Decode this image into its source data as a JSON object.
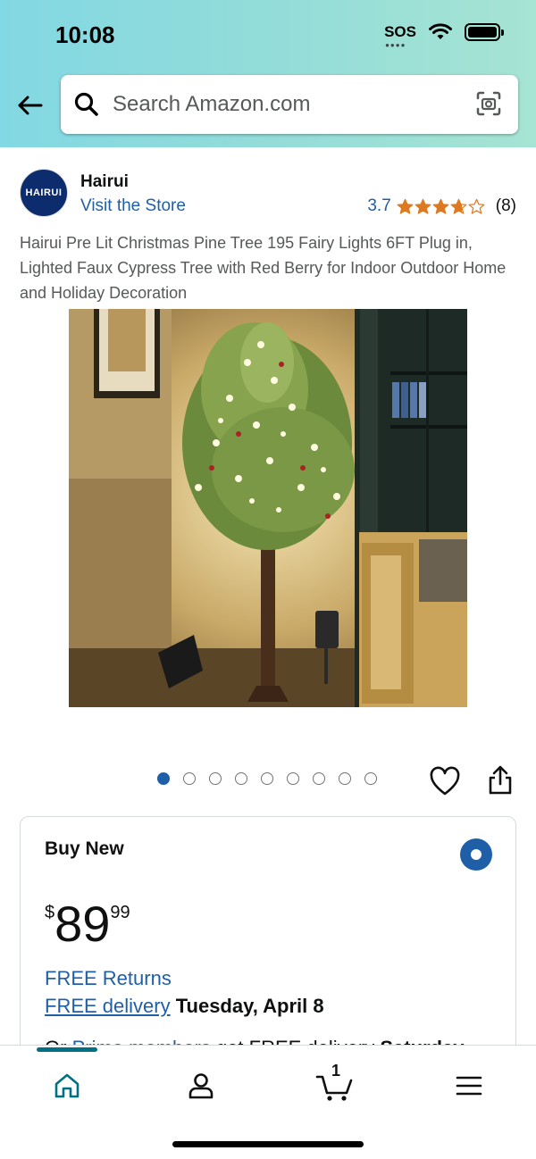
{
  "status_bar": {
    "time": "10:08",
    "carrier": "SOS"
  },
  "search": {
    "placeholder": "Search Amazon.com"
  },
  "store": {
    "logo_text": "HAIRUI",
    "name": "Hairui",
    "link": "Visit the Store",
    "rating": "3.7",
    "rating_value": 3.7,
    "rating_count": "(8)"
  },
  "product": {
    "title": "Hairui Pre Lit Christmas Pine Tree 195 Fairy Lights 6FT Plug in, Lighted Faux Cypress Tree with Red Berry for Indoor Outdoor Home and Holiday Decoration",
    "image_count": 9,
    "active_image": 0
  },
  "buy_box": {
    "label": "Buy New",
    "price_currency": "$",
    "price_whole": "89",
    "price_fraction": "99",
    "free_returns": "FREE Returns",
    "free_delivery_link": "FREE delivery",
    "delivery_date": "Tuesday, April 8",
    "cutoff_prefix": "Or",
    "cutoff_link": "Prime members",
    "cutoff_rest": "get FREE delivery",
    "cutoff_date": "Saturday"
  },
  "bottom_nav": {
    "items": [
      "home",
      "account",
      "cart",
      "menu"
    ],
    "active": "home",
    "cart_count": "1"
  },
  "colors": {
    "link": "#1f5fa8",
    "accent_teal": "#007185",
    "star": "#de7921"
  }
}
